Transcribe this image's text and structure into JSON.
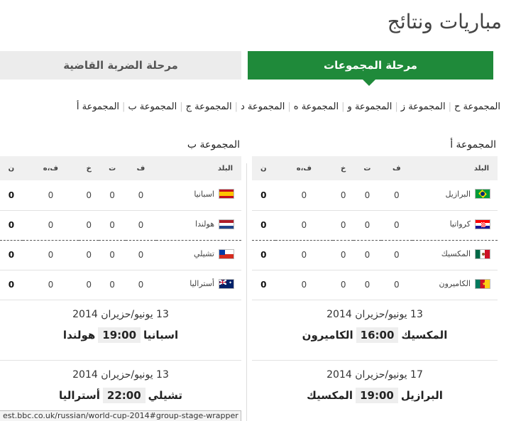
{
  "page_title": "مباريات ونتائج",
  "stage_tabs": {
    "groups": "مرحلة المجموعات",
    "knockout": "مرحلة الضربة القاضية"
  },
  "group_nav": [
    "المجموعة ح",
    "المجموعة ز",
    "المجموعة و",
    "المجموعة ه",
    "المجموعة د",
    "المجموعة ج",
    "المجموعة ب",
    "المجموعة أ"
  ],
  "table_headers": {
    "country": "البلد",
    "played": "ف",
    "won": "ت",
    "drawn": "خ",
    "diff": "ف،ه",
    "points": "ن"
  },
  "groups": [
    {
      "title": "المجموعة أ",
      "teams": [
        {
          "name": "البرازيل",
          "flag": "brazil-flag",
          "played": "0",
          "won": "0",
          "drawn": "0",
          "diff": "0",
          "points": "0"
        },
        {
          "name": "كرواتيا",
          "flag": "croatia-flag",
          "played": "0",
          "won": "0",
          "drawn": "0",
          "diff": "0",
          "points": "0"
        },
        {
          "name": "المكسيك",
          "flag": "mexico-flag",
          "played": "0",
          "won": "0",
          "drawn": "0",
          "diff": "0",
          "points": "0"
        },
        {
          "name": "الكاميرون",
          "flag": "cameroon-flag",
          "played": "0",
          "won": "0",
          "drawn": "0",
          "diff": "0",
          "points": "0"
        }
      ],
      "matches": [
        {
          "date": "13 يونيو/حزيران 2014",
          "home": "المكسيك",
          "time": "16:00",
          "away": "الكاميرون"
        },
        {
          "date": "17 يونيو/حزيران 2014",
          "home": "البرازيل",
          "time": "19:00",
          "away": "المكسيك"
        }
      ]
    },
    {
      "title": "المجموعة ب",
      "teams": [
        {
          "name": "اسبانيا",
          "flag": "spain-flag",
          "played": "0",
          "won": "0",
          "drawn": "0",
          "diff": "0",
          "points": "0"
        },
        {
          "name": "هولندا",
          "flag": "netherlands-flag",
          "played": "0",
          "won": "0",
          "drawn": "0",
          "diff": "0",
          "points": "0"
        },
        {
          "name": "تشيلي",
          "flag": "chile-flag",
          "played": "0",
          "won": "0",
          "drawn": "0",
          "diff": "0",
          "points": "0"
        },
        {
          "name": "أستراليا",
          "flag": "australia-flag",
          "played": "0",
          "won": "0",
          "drawn": "0",
          "diff": "0",
          "points": "0"
        }
      ],
      "matches": [
        {
          "date": "13 يونيو/حزيران 2014",
          "home": "اسبانيا",
          "time": "19:00",
          "away": "هولندا"
        },
        {
          "date": "13 يونيو/حزيران 2014",
          "home": "تشيلي",
          "time": "22:00",
          "away": "أستراليا"
        }
      ]
    }
  ],
  "status_bar": "est.bbc.co.uk/russian/world-cup-2014#group-stage-wrapper",
  "colors": {
    "accent": "#1f8a3a",
    "tab_inactive": "#ececec"
  }
}
